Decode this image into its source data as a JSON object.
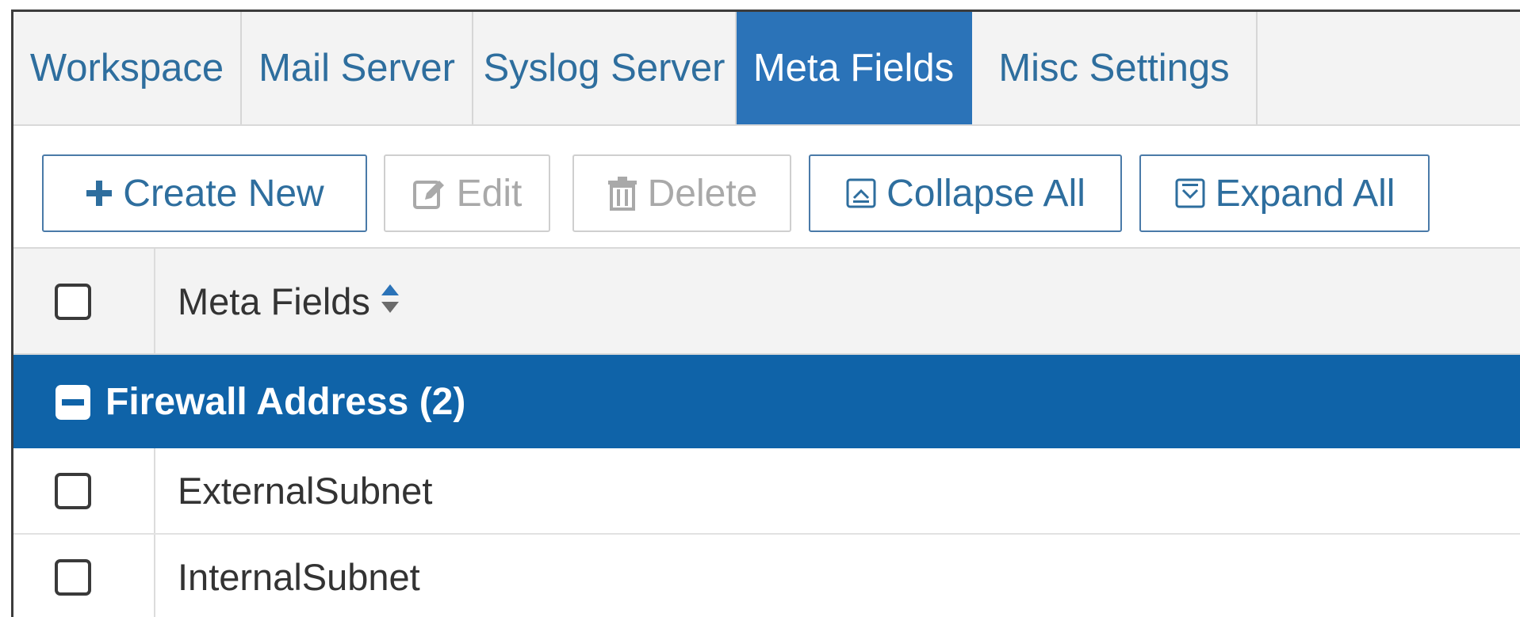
{
  "tabs": [
    {
      "label": "Workspace",
      "active": false
    },
    {
      "label": "Mail Server",
      "active": false
    },
    {
      "label": "Syslog Server",
      "active": false
    },
    {
      "label": "Meta Fields",
      "active": true
    },
    {
      "label": "Misc Settings",
      "active": false
    }
  ],
  "toolbar": {
    "create_new": "Create New",
    "edit": "Edit",
    "delete": "Delete",
    "collapse_all": "Collapse All",
    "expand_all": "Expand All"
  },
  "table": {
    "header": {
      "label": "Meta Fields"
    },
    "group": {
      "label": "Firewall Address (2)"
    },
    "rows": [
      {
        "label": "ExternalSubnet"
      },
      {
        "label": "InternalSubnet"
      }
    ]
  },
  "colors": {
    "accent": "#2b73b8",
    "group_bg": "#0f63a8",
    "link_text": "#2e6e9e",
    "disabled_text": "#a9a9a9"
  },
  "icons": {
    "create_new": "plus-icon",
    "edit": "edit-icon",
    "delete": "trash-icon",
    "collapse_all": "collapse-icon",
    "expand_all": "expand-icon",
    "sort": "sort-icon",
    "group_toggle": "minus-square-icon"
  }
}
